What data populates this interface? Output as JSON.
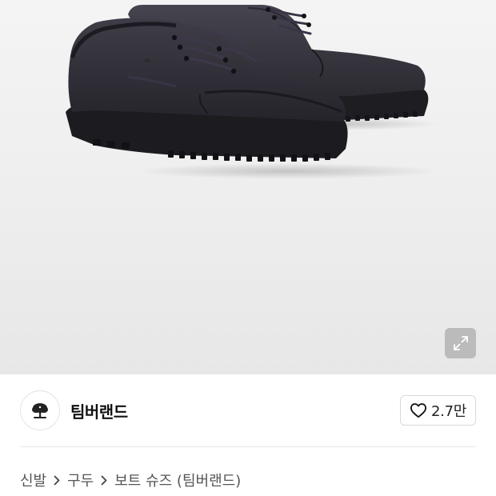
{
  "product": {
    "image_alt": "Timberland 3-eye classic boat shoes, black nubuck"
  },
  "brand": {
    "name": "팀버랜드",
    "logo_icon": "timberland-tree-icon"
  },
  "like": {
    "icon": "heart-outline-icon",
    "count": "2.7만"
  },
  "breadcrumb": {
    "items": [
      "신발",
      "구두",
      "보트 슈즈 (팀버랜드)"
    ],
    "separator_icon": "chevron-right-icon"
  },
  "colors": {
    "hero_background": "#efefef",
    "expand_button_bg": "#999999",
    "divider": "#e6e6e6"
  }
}
